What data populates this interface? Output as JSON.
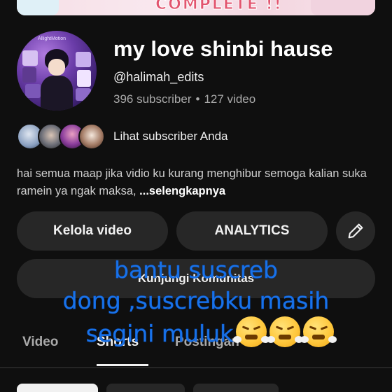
{
  "banner": {
    "text": "COMPLETE !!"
  },
  "channel": {
    "avatar_caption": "AllightMotion",
    "name": "my love shinbi hause",
    "handle": "@halimah_edits",
    "subscribers": "396 subscriber",
    "separator": "•",
    "videos": "127 video"
  },
  "subscribers_link": {
    "label": "Lihat subscriber Anda"
  },
  "description": {
    "text": "hai semua maap jika vidio ku kurang menghibur semoga kalian suka ramein ya ngak maksa, ",
    "more_label": "...selengkapnya"
  },
  "buttons": {
    "manage_videos": "Kelola video",
    "analytics": "ANALYTICS",
    "community": "Kunjungi Komunitas",
    "edit_icon": "pencil-icon"
  },
  "tabs": [
    {
      "label": "Video"
    },
    {
      "label": "Shorts"
    },
    {
      "label": "Postingan"
    }
  ],
  "overlay": {
    "line1": "bantu suscreb",
    "line2": "dong ,suscrebku masih",
    "line3": "segini muluk",
    "emoji": "angry-face-emoji",
    "color": "#1a73e8"
  },
  "colors": {
    "background": "#0f0f0f",
    "button_bg": "#272727",
    "text_primary": "#f1f1f1",
    "text_secondary": "#aaaaaa"
  }
}
